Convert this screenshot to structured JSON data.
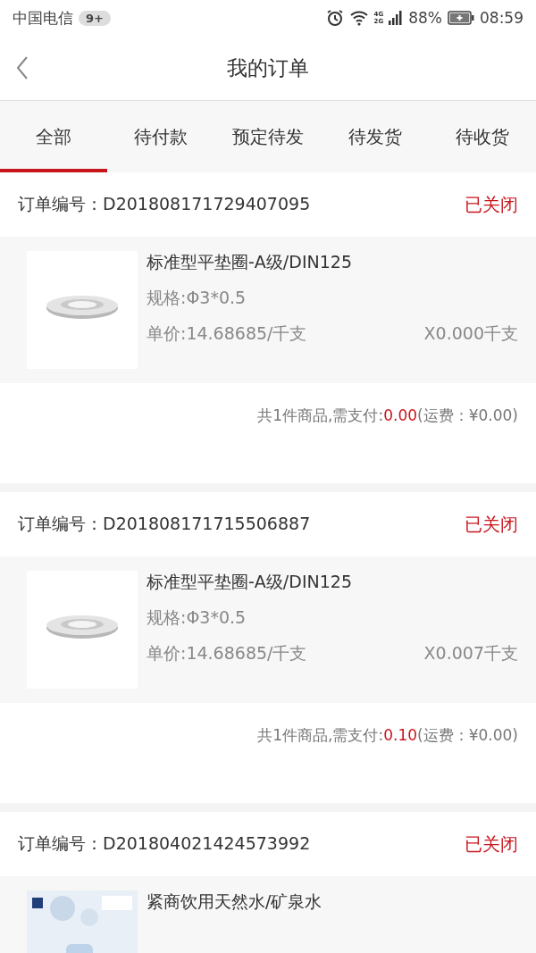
{
  "status_bar": {
    "carrier": "中国电信",
    "badge": "9+",
    "network_top": "4G",
    "network_bottom": "2G",
    "battery": "88%",
    "time": "08:59"
  },
  "header": {
    "title": "我的订单"
  },
  "tabs": [
    {
      "label": "全部",
      "selected": true
    },
    {
      "label": "待付款",
      "selected": false
    },
    {
      "label": "预定待发",
      "selected": false
    },
    {
      "label": "待发货",
      "selected": false
    },
    {
      "label": "待收货",
      "selected": false
    }
  ],
  "orders": [
    {
      "label": "订单编号：",
      "number": "D201808171729407095",
      "status": "已关闭",
      "items": [
        {
          "kind": "washer",
          "name": "标准型平垫圈-A级/DIN125",
          "spec": "规格:Φ3*0.5",
          "price": "单价:14.68685/千支",
          "qty": "X0.000千支"
        }
      ],
      "summary": {
        "text": "共1件商品,需支付:",
        "amount": "0.00",
        "shipping": "(运费：¥0.00)"
      }
    },
    {
      "label": "订单编号：",
      "number": "D201808171715506887",
      "status": "已关闭",
      "items": [
        {
          "kind": "washer",
          "name": "标准型平垫圈-A级/DIN125",
          "spec": "规格:Φ3*0.5",
          "price": "单价:14.68685/千支",
          "qty": "X0.007千支"
        }
      ],
      "summary": {
        "text": "共1件商品,需支付:",
        "amount": "0.10",
        "shipping": "(运费：¥0.00)"
      }
    },
    {
      "label": "订单编号：",
      "number": "D201804021424573992",
      "status": "已关闭",
      "items": [
        {
          "kind": "bottle",
          "name": "紧商饮用天然水/矿泉水"
        }
      ]
    }
  ]
}
